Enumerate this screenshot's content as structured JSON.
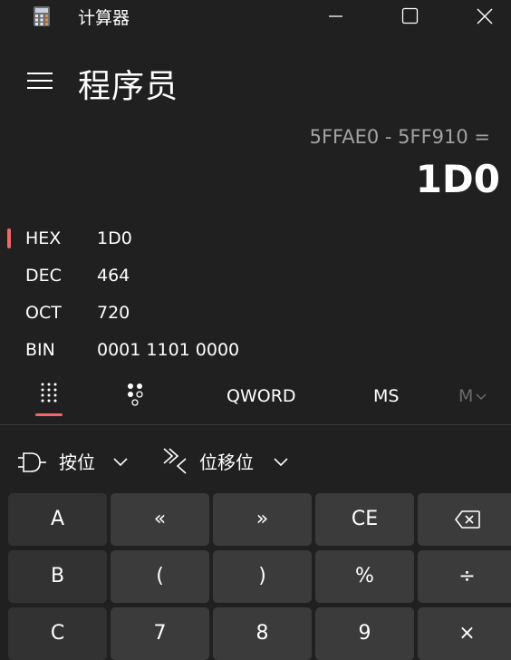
{
  "window": {
    "title": "计算器",
    "icon": "calculator-icon",
    "controls": [
      "minimize-icon",
      "maximize-icon",
      "close-icon"
    ]
  },
  "header": {
    "menu_icon": "hamburger-menu-icon",
    "mode": "程序员"
  },
  "display": {
    "expression": "5FFAE0 - 5FF910 =",
    "result": "1D0"
  },
  "radix": [
    {
      "label": "HEX",
      "value": "1D0",
      "selected": true
    },
    {
      "label": "DEC",
      "value": "464",
      "selected": false
    },
    {
      "label": "OCT",
      "value": "720",
      "selected": false
    },
    {
      "label": "BIN",
      "value": "0001 1101 0000",
      "selected": false
    }
  ],
  "toolbar": {
    "full_keypad_icon": "full-keypad-icon",
    "bit_toggle_icon": "bit-toggle-keypad-icon",
    "word_size": "QWORD",
    "memory_store": "MS",
    "memory_list": "M"
  },
  "dropdowns": {
    "bitwise": "按位",
    "bitshift": "位移位"
  },
  "keys": {
    "row1": [
      "A",
      "«",
      "»",
      "CE",
      "backspace-icon"
    ],
    "row2": [
      "B",
      "(",
      ")",
      "%",
      "÷"
    ],
    "row3": [
      "C",
      "7",
      "8",
      "9",
      "×"
    ]
  },
  "colors": {
    "background": "#202020",
    "accent": "#f0686a",
    "key": "#3b3b3b",
    "secondary_text": "#a3a3a3"
  }
}
